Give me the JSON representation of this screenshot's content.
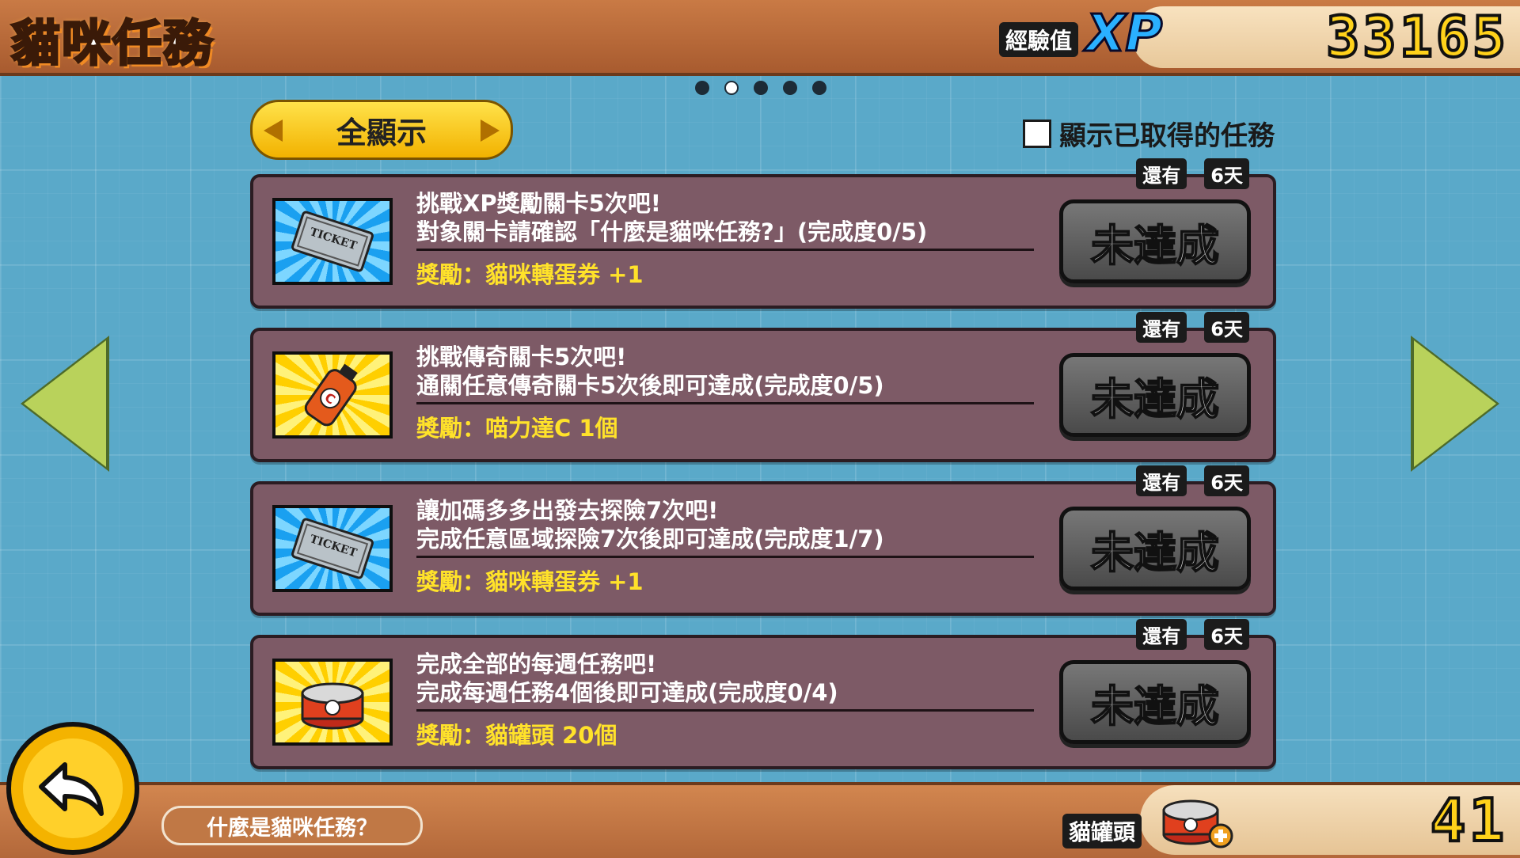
{
  "header": {
    "title": "貓咪任務",
    "xp_label": "經驗值",
    "xp_word": "XP",
    "xp_value": "33165"
  },
  "pagination": {
    "total": 5,
    "active": 1
  },
  "filter": {
    "label": "全顯示",
    "show_obtained_label": "顯示已取得的任務",
    "show_obtained_checked": false
  },
  "missions": [
    {
      "title": "挑戰XP獎勵關卡5次吧!",
      "desc": "對象關卡請確認「什麼是貓咪任務?」(完成度0/5)",
      "reward": "獎勵：貓咪轉蛋券 +1",
      "deadline_prefix": "還有",
      "deadline_days": "6天",
      "status": "未達成",
      "icon": "ticket-icon"
    },
    {
      "title": "挑戰傳奇關卡5次吧!",
      "desc": "通關任意傳奇關卡5次後即可達成(完成度0/5)",
      "reward": "獎勵：喵力達C 1個",
      "deadline_prefix": "還有",
      "deadline_days": "6天",
      "status": "未達成",
      "icon": "energy-drink-icon"
    },
    {
      "title": "讓加碼多多出發去探險7次吧!",
      "desc": "完成任意區域探險7次後即可達成(完成度1/7)",
      "reward": "獎勵：貓咪轉蛋券 +1",
      "deadline_prefix": "還有",
      "deadline_days": "6天",
      "status": "未達成",
      "icon": "ticket-icon"
    },
    {
      "title": "完成全部的每週任務吧!",
      "desc": "完成每週任務4個後即可達成(完成度0/4)",
      "reward": "獎勵：貓罐頭 20個",
      "deadline_prefix": "還有",
      "deadline_days": "6天",
      "status": "未達成",
      "icon": "cat-food-can-icon"
    }
  ],
  "footer": {
    "help_label": "什麼是貓咪任務？",
    "can_label": "貓罐頭",
    "can_value": "41"
  },
  "colors": {
    "background": "#5aa9c9",
    "topbar": "#b8683a",
    "mission_card": "#7d5a66",
    "reward_text": "#ffe22a",
    "xp_value": "#ffd21a",
    "arrow": "#b9d25b"
  }
}
